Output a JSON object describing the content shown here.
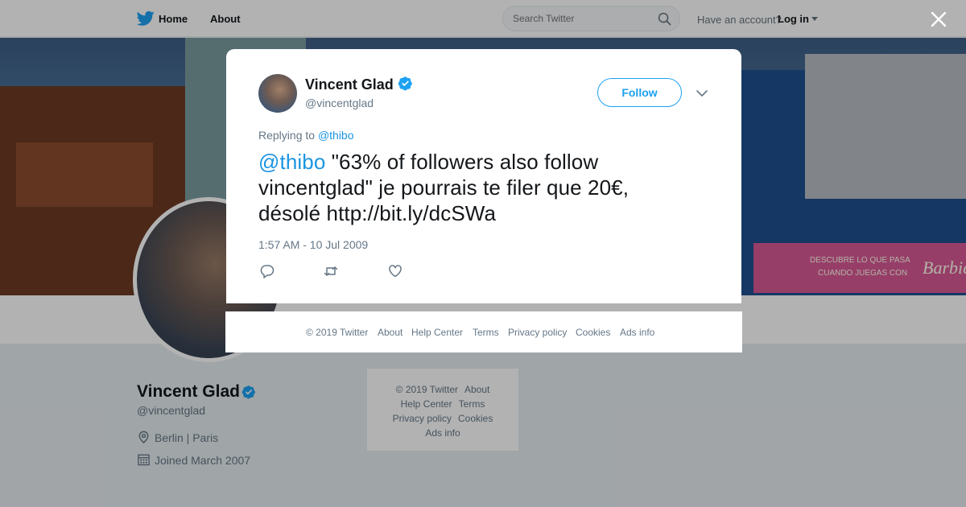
{
  "nav": {
    "home": "Home",
    "about": "About",
    "search_placeholder": "Search Twitter",
    "have_account": "Have an account?",
    "login": "Log in"
  },
  "profile": {
    "name": "Vincent Glad",
    "handle": "@vincentglad",
    "location": "Berlin | Paris",
    "joined": "Joined March 2007"
  },
  "side_footer": {
    "links": [
      "© 2019 Twitter",
      "About",
      "Help Center",
      "Terms",
      "Privacy policy",
      "Cookies",
      "Ads info"
    ]
  },
  "banner": {
    "sign_line1": "DESCUBRE LO QUE PASA",
    "sign_line2": "CUANDO JUEGAS CON",
    "sign_brand": "Barbie"
  },
  "tweet": {
    "author_name": "Vincent Glad",
    "author_handle": "@vincentglad",
    "follow_label": "Follow",
    "replying_prefix": "Replying to",
    "replying_to": "@thibo",
    "text_mention": "@thibo",
    "text_body": " \"63% of followers also follow vincentglad\" je pourrais te filer que 20€, désolé http://bit.ly/dcSWa",
    "timestamp": "1:57 AM - 10 Jul 2009"
  },
  "modal_footer": {
    "links": [
      "© 2019 Twitter",
      "About",
      "Help Center",
      "Terms",
      "Privacy policy",
      "Cookies",
      "Ads info"
    ]
  },
  "colors": {
    "accent": "#1da1f2",
    "link": "#1b95e0",
    "muted": "#657786"
  },
  "icons": [
    "twitter-bird-icon",
    "search-icon",
    "caret-down-icon",
    "close-icon",
    "verified-badge-icon",
    "chevron-down-icon",
    "reply-icon",
    "retweet-icon",
    "like-icon",
    "location-icon",
    "calendar-icon"
  ]
}
